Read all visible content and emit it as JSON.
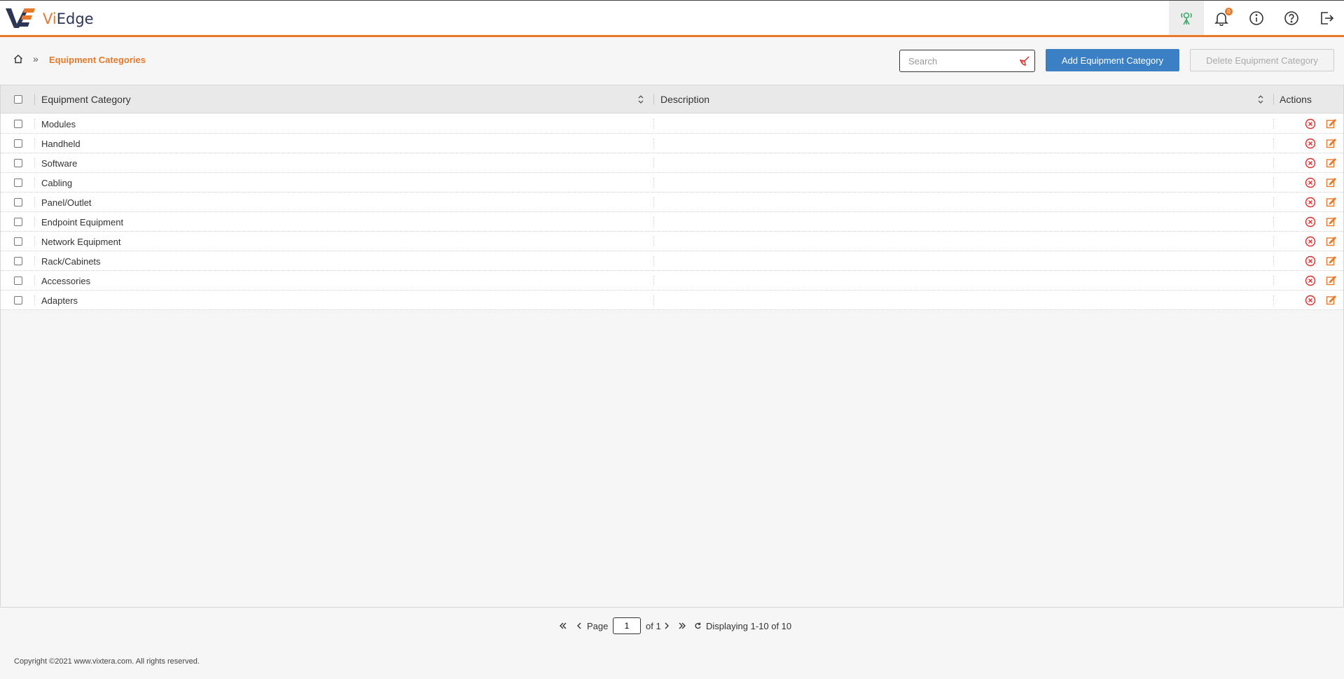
{
  "header": {
    "brand_prefix": "Vi",
    "brand_suffix": "Edge",
    "notification_count": "0",
    "icons": [
      "network-status-icon",
      "bell-icon",
      "info-icon",
      "help-icon",
      "logout-icon"
    ]
  },
  "breadcrumb": {
    "home_icon": "home-icon",
    "separator": "»",
    "current": "Equipment Categories"
  },
  "toolbar": {
    "search_placeholder": "Search",
    "search_value": "",
    "add_label": "Add Equipment Category",
    "delete_label": "Delete Equipment Category"
  },
  "grid": {
    "columns": {
      "category": "Equipment Category",
      "description": "Description",
      "actions": "Actions"
    },
    "rows": [
      {
        "name": "Modules",
        "description": ""
      },
      {
        "name": "Handheld",
        "description": ""
      },
      {
        "name": "Software",
        "description": ""
      },
      {
        "name": "Cabling",
        "description": ""
      },
      {
        "name": "Panel/Outlet",
        "description": ""
      },
      {
        "name": "Endpoint Equipment",
        "description": ""
      },
      {
        "name": "Network Equipment",
        "description": ""
      },
      {
        "name": "Rack/Cabinets",
        "description": ""
      },
      {
        "name": "Accessories",
        "description": ""
      },
      {
        "name": "Adapters",
        "description": ""
      }
    ]
  },
  "pager": {
    "page_label": "Page",
    "page_value": "1",
    "of_label": "of 1",
    "display_text": "Displaying 1-10 of 10"
  },
  "footer": {
    "copyright": "Copyright ©2021 www.vixtera.com. All rights reserved."
  },
  "colors": {
    "accent": "#e8782a",
    "primary_button": "#3b7fc4",
    "delete_icon": "#e02b2b",
    "status_green": "#3aa86b"
  }
}
